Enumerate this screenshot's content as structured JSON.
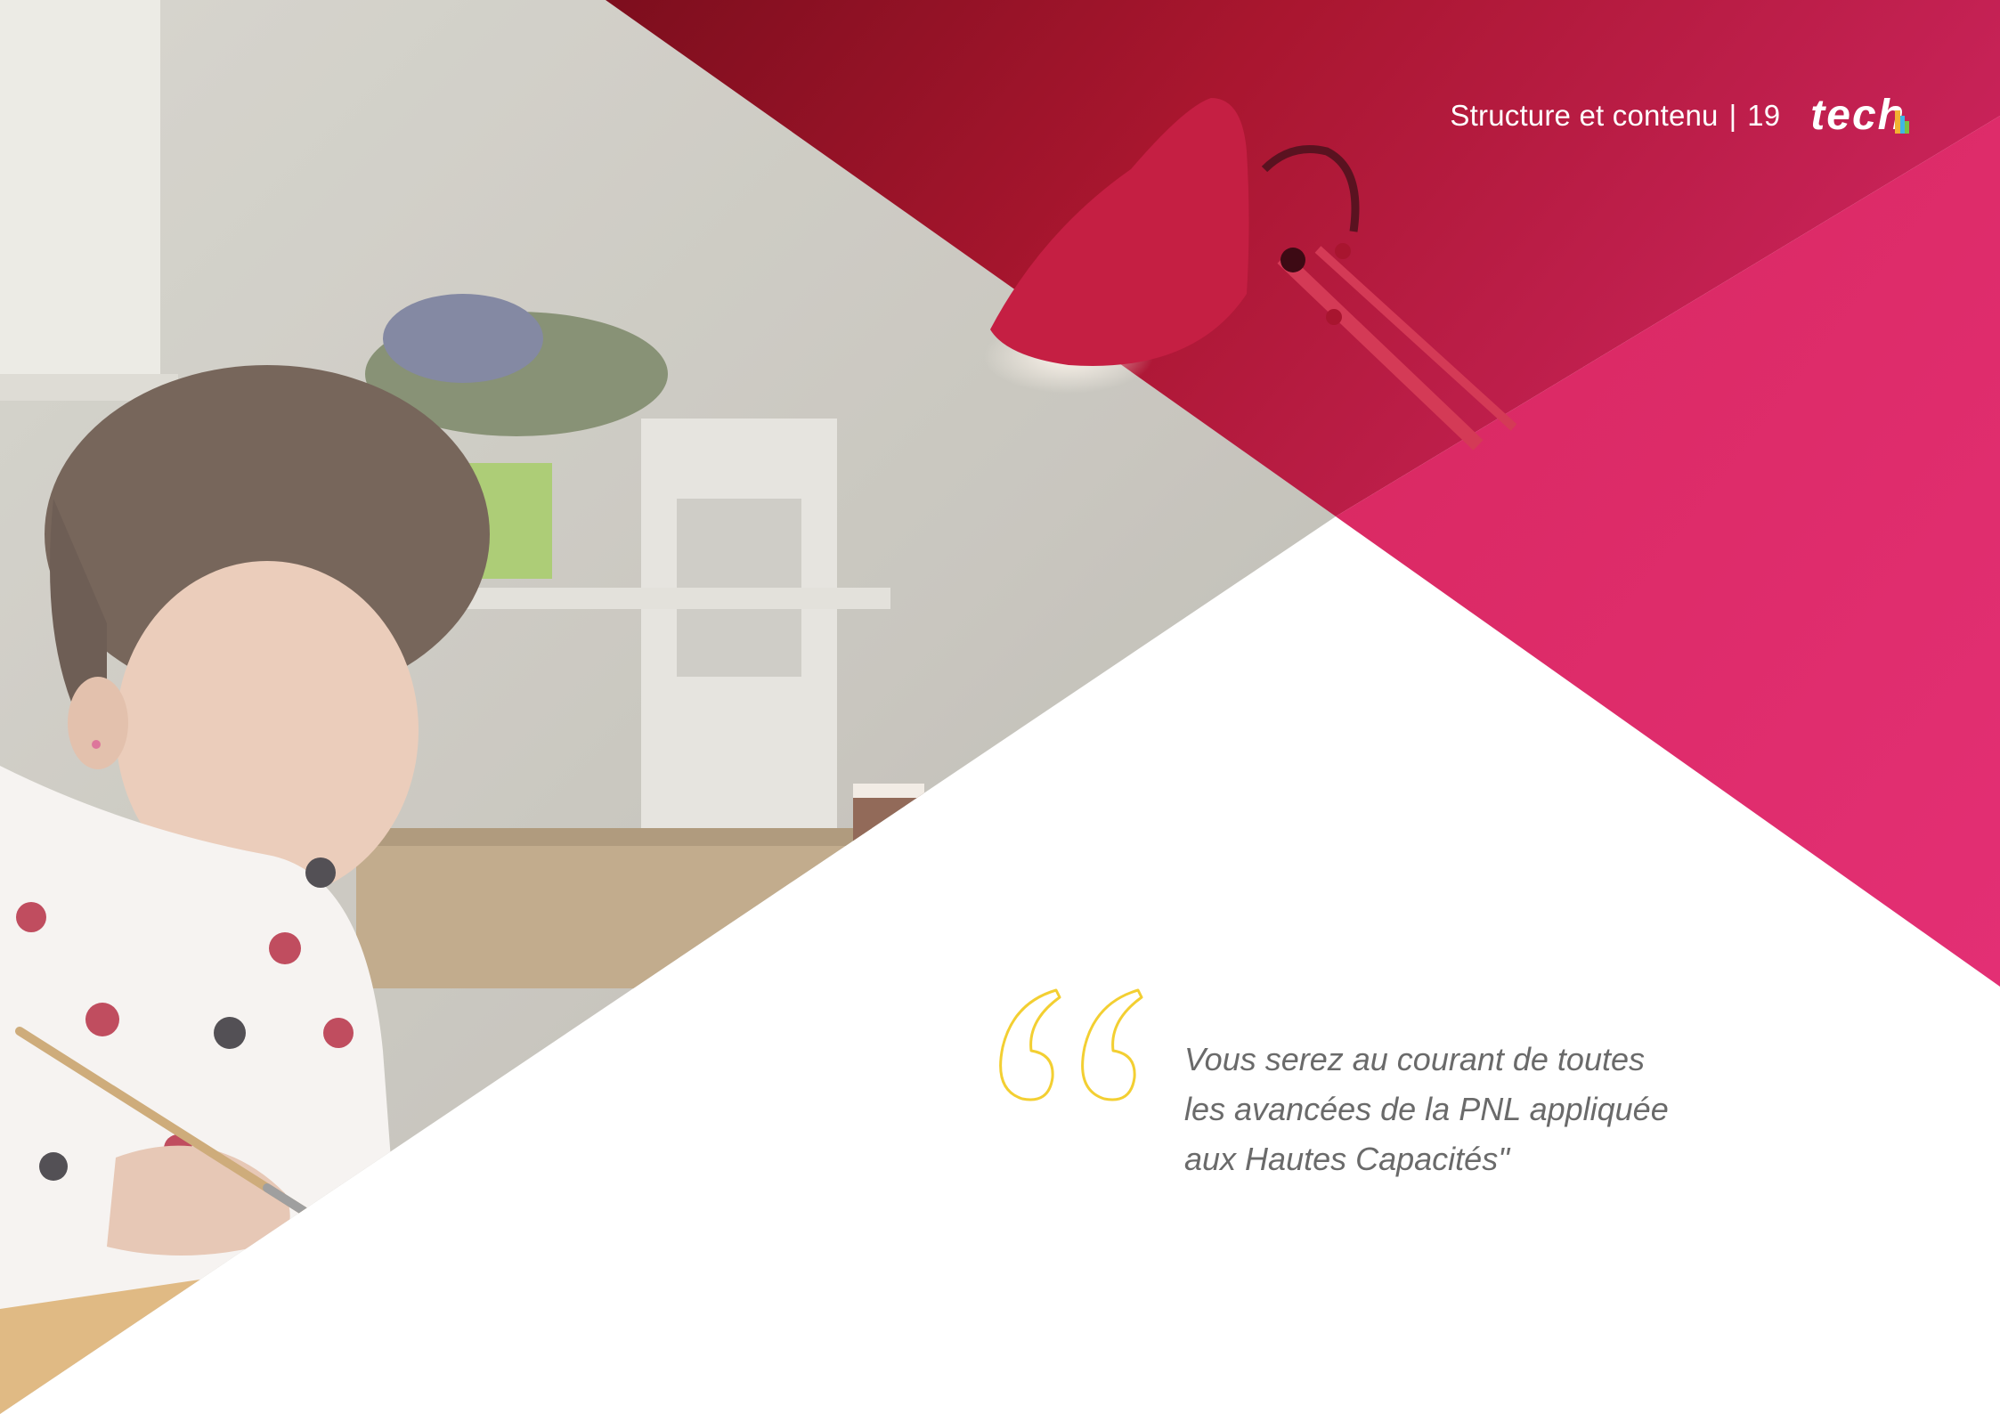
{
  "header": {
    "section_title": "Structure et contenu",
    "separator": "|",
    "page_number": "19",
    "logo_text": "tech"
  },
  "quote": {
    "lines": [
      "Vous serez au courant de toutes",
      "les avancées de la PNL appliquée",
      "aux Hautes Capacités\""
    ]
  },
  "colors": {
    "magenta": "#de2b6f",
    "crimson": "#8e1427",
    "quote_mark_yellow": "#f3cf32",
    "quote_text_gray": "#6a6a6a",
    "background": "#ffffff"
  },
  "icons": {
    "quote_mark": "opening-quote-outline-icon",
    "logo": "tech-logo"
  }
}
